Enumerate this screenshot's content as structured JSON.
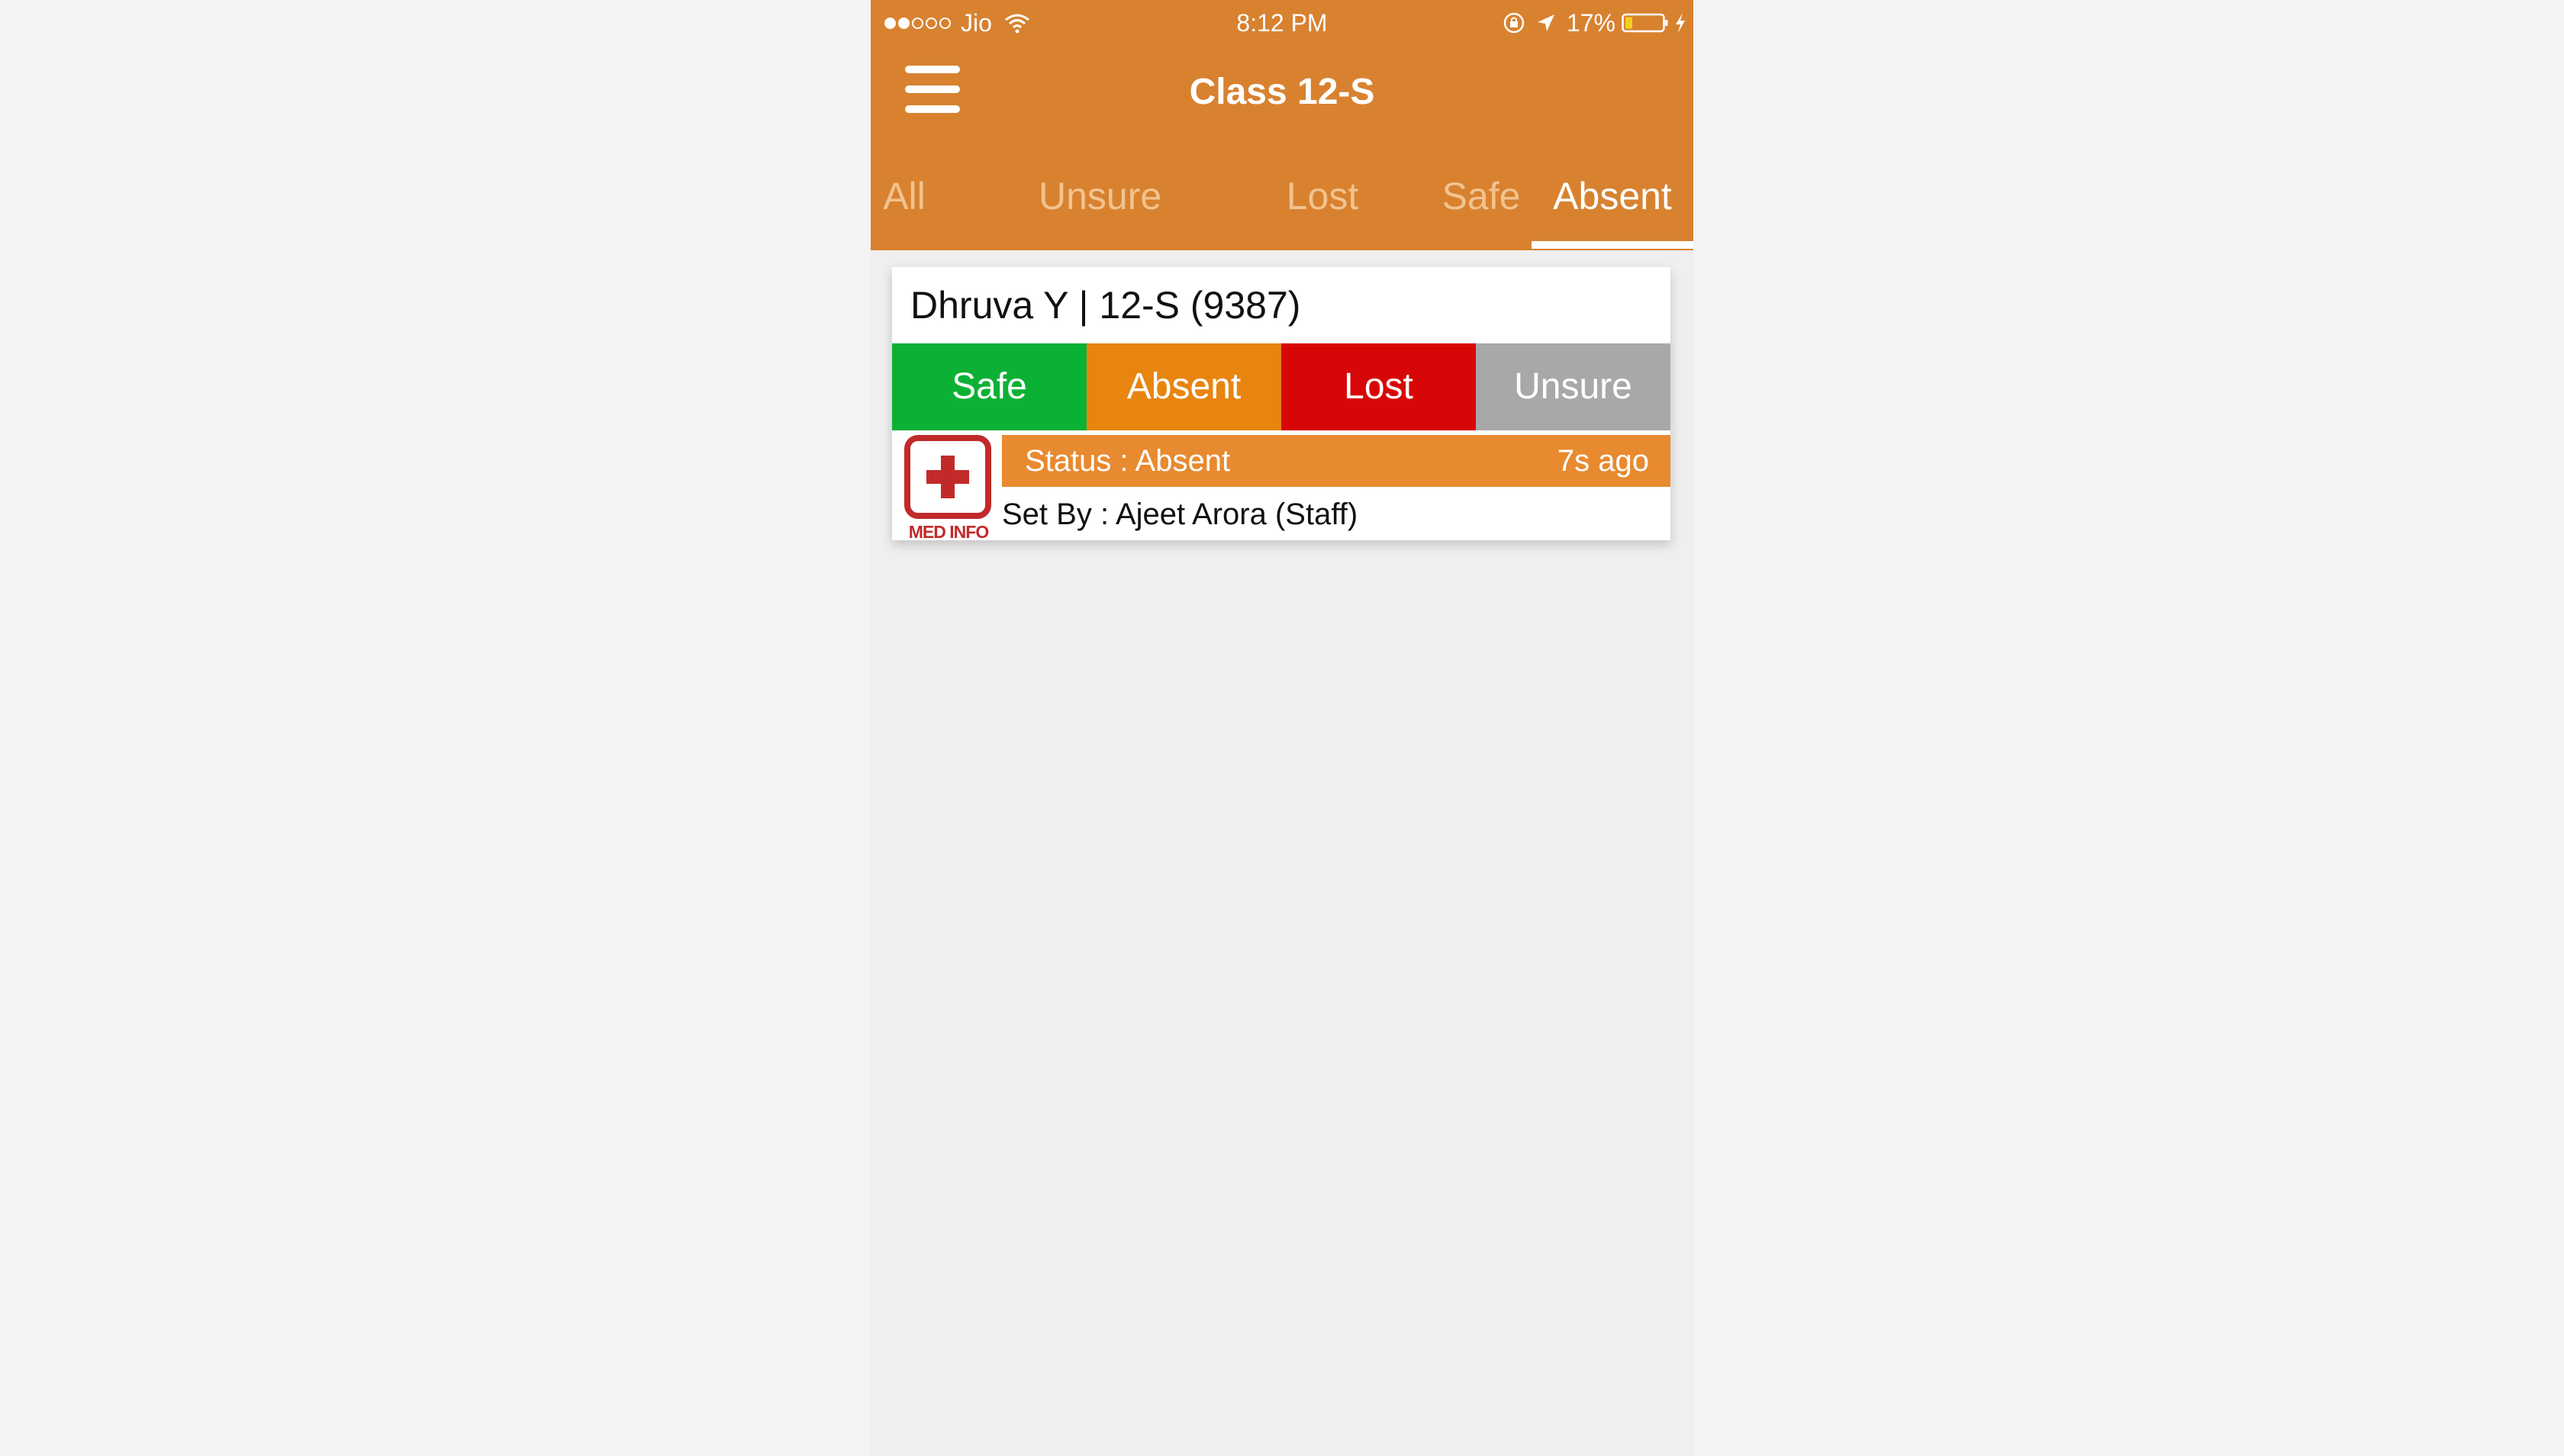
{
  "status_bar": {
    "carrier": "Jio",
    "time": "8:12 PM",
    "battery": "17%"
  },
  "header": {
    "title": "Class 12-S"
  },
  "tabs": [
    {
      "label": "All"
    },
    {
      "label": "Unsure"
    },
    {
      "label": "Lost"
    },
    {
      "label": "Safe"
    },
    {
      "label": "Absent"
    }
  ],
  "active_tab": "Absent",
  "student": {
    "name": "Dhruva Y | 12-S (9387)",
    "buttons": {
      "safe": "Safe",
      "absent": "Absent",
      "lost": "Lost",
      "unsure": "Unsure"
    },
    "med_info_label": "MED INFO",
    "status": "Status : Absent",
    "status_time": "7s ago",
    "set_by": "Set By : Ajeet Arora (Staff)"
  },
  "colors": {
    "header": "#d88230",
    "safe": "#0bb134",
    "absent": "#e8850f",
    "lost": "#d80707",
    "unsure": "#a8a8a8",
    "med": "#c22a2a"
  }
}
